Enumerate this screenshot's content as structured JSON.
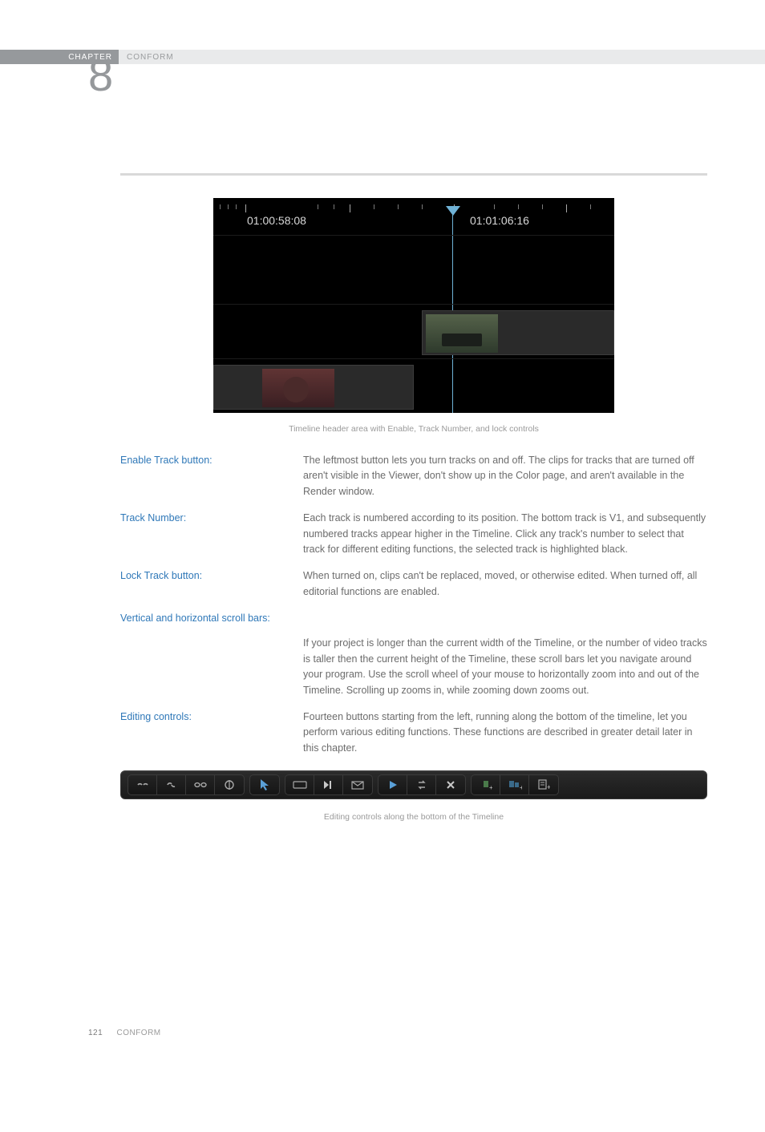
{
  "header": {
    "chapter_label": "CHAPTER",
    "chapter_title": "CONFORM",
    "chapter_number": "8"
  },
  "figure1": {
    "tc_left": "01:00:58:08",
    "tc_right": "01:01:06:16",
    "caption": "Timeline header area with Enable, Track Number, and lock controls"
  },
  "definitions": [
    {
      "term": "Enable Track button:",
      "desc": "The leftmost button lets you turn tracks on and off. The clips for tracks that are turned off aren't visible in the Viewer, don't show up in the Color page, and aren't available in the Render window."
    },
    {
      "term": "Track Number:",
      "desc": "Each track is numbered according to its position. The bottom track is V1, and subsequently numbered tracks appear higher in the Timeline. Click any track's number to select that track for different editing functions, the selected track is highlighted black."
    },
    {
      "term": "Lock Track button:",
      "desc": "When turned on, clips can't be replaced, moved, or otherwise edited. When turned off, all editorial functions are enabled."
    }
  ],
  "scroll_section": {
    "label": "Vertical and horizontal scroll bars:",
    "desc": "If your project is longer than the current width of the Timeline, or the number of video tracks is taller then the current height of the Timeline, these scroll bars let you navigate around your program. Use the scroll wheel of your mouse to horizontally zoom into and out of the Timeline. Scrolling up zooms in, while zooming down zooms out."
  },
  "editing_controls": {
    "term": "Editing controls:",
    "desc": "Fourteen buttons starting from the left, running along the bottom of the timeline, let you perform various editing functions. These functions are described in greater detail later in this chapter."
  },
  "toolbar_caption": "Editing controls along the bottom of the Timeline",
  "footer": {
    "page": "121",
    "title": "CONFORM"
  }
}
